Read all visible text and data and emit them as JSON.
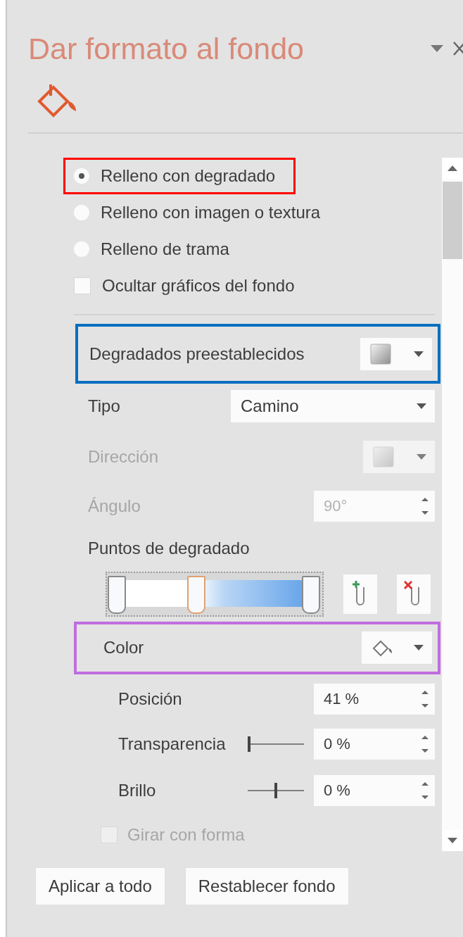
{
  "panel": {
    "title": "Dar formato al fondo"
  },
  "fill_options": [
    {
      "kind": "radio",
      "label": "Relleno con degradado",
      "selected": true,
      "color": "#ff0000"
    },
    {
      "kind": "radio",
      "label": "Relleno con imagen o textura",
      "selected": false
    },
    {
      "kind": "radio",
      "label": "Relleno de trama",
      "selected": false
    },
    {
      "kind": "checkbox",
      "label": "Ocultar gráficos del fondo",
      "checked": false
    }
  ],
  "gradient": {
    "presets": {
      "label": "Degradados preestablecidos",
      "color": "#0070c0"
    },
    "type": {
      "label": "Tipo",
      "value": "Camino"
    },
    "direction": {
      "label": "Dirección",
      "disabled": true
    },
    "angle": {
      "label": "Ángulo",
      "value": "90°",
      "disabled": true
    },
    "stops_label": "Puntos de degradado",
    "stops": [
      {
        "level": 0,
        "selected": false
      },
      {
        "level": 0.41,
        "selected": true
      },
      {
        "level": 1,
        "selected": false
      }
    ],
    "color": {
      "label": "Color",
      "color": "#c06ee0"
    },
    "position": {
      "label": "Posición",
      "value": "41 %"
    },
    "transparency": {
      "label": "Transparencia",
      "level": 0,
      "value": "0 %"
    },
    "brightness": {
      "label": "Brillo",
      "level": 0.5,
      "value": "0 %"
    },
    "rotate": {
      "label": "Girar con forma",
      "checked": false,
      "disabled": true
    }
  },
  "buttons": [
    "Aplicar a todo",
    "Restablecer fondo"
  ]
}
